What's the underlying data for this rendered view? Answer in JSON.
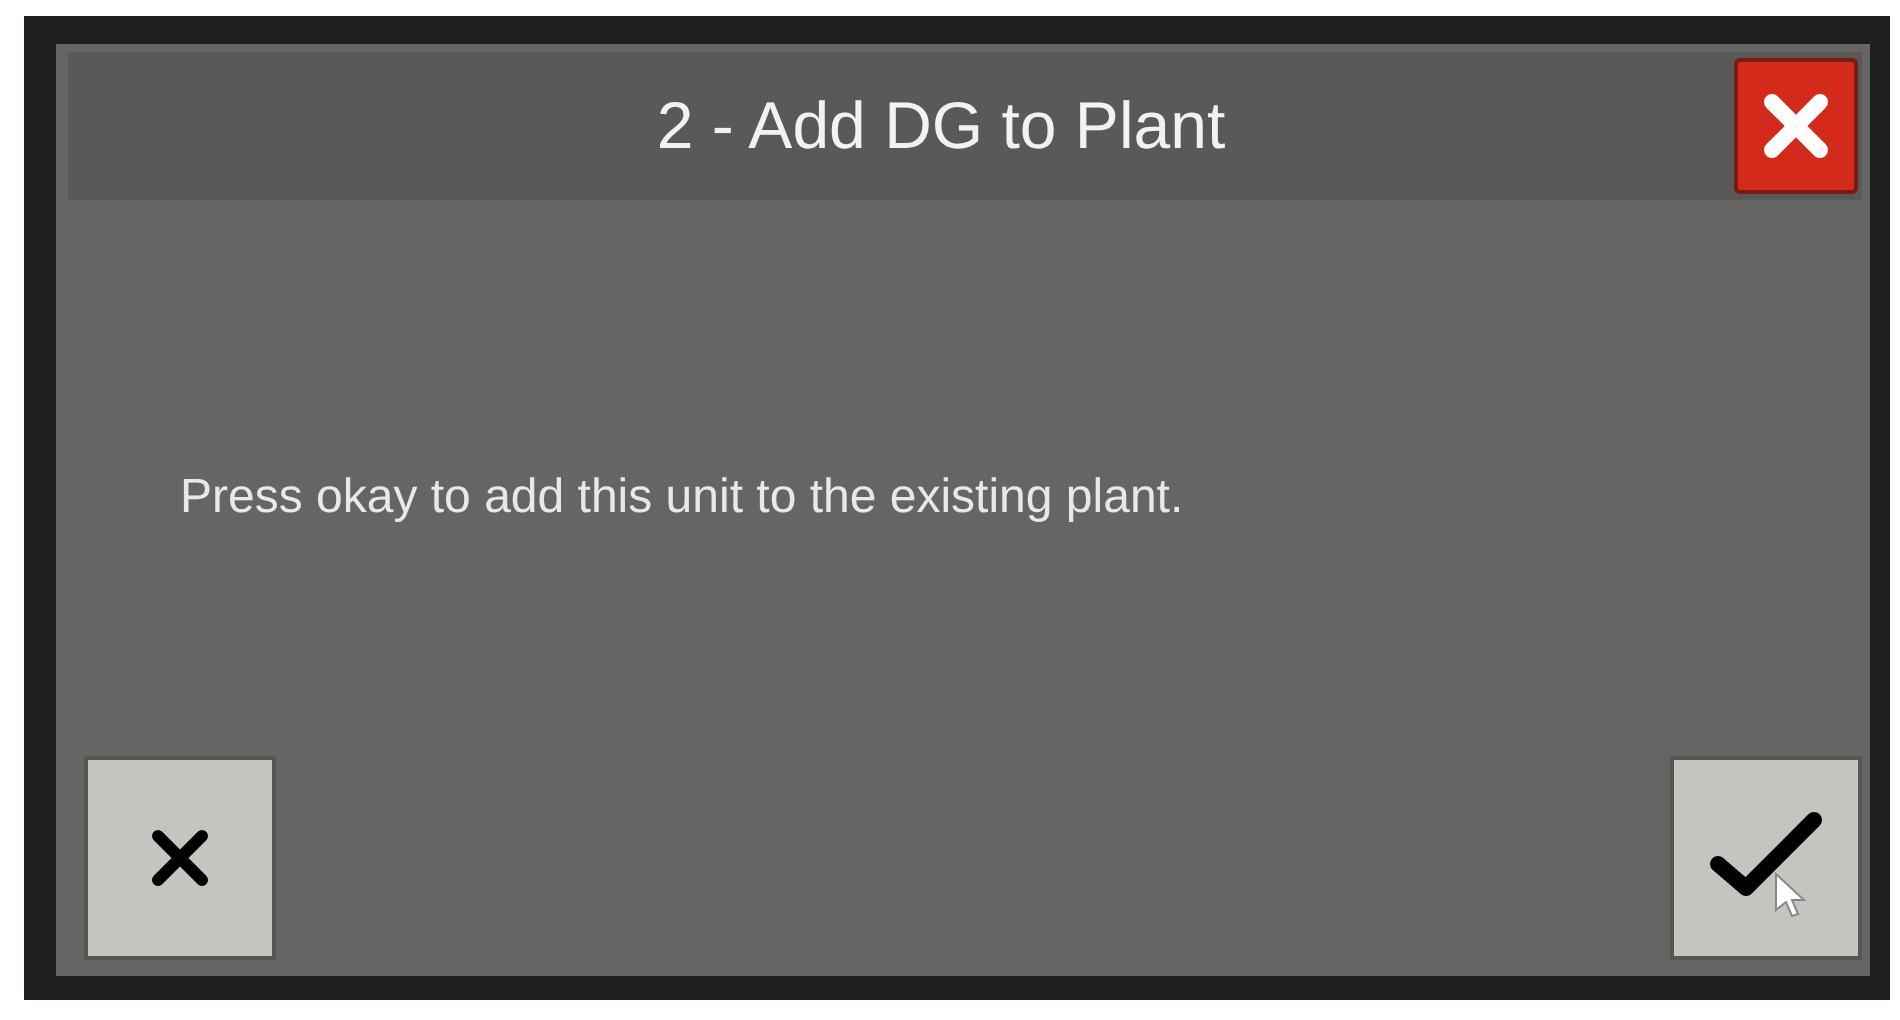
{
  "dialog": {
    "title": "2 - Add DG to Plant",
    "message": "Press okay to add this unit to the existing plant."
  }
}
